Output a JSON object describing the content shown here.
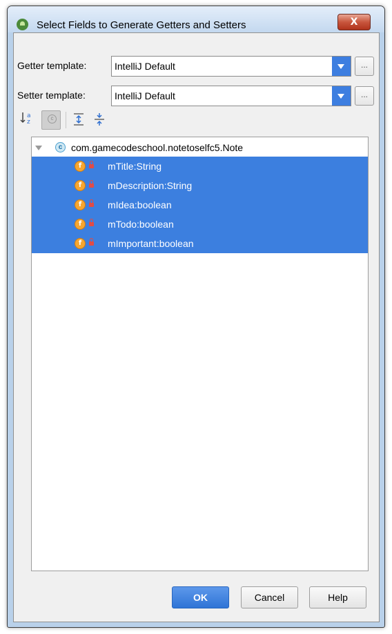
{
  "window": {
    "title": "Select Fields to Generate Getters and Setters",
    "close_glyph": "X"
  },
  "getter": {
    "label": "Getter template:",
    "value": "IntelliJ Default",
    "more": "..."
  },
  "setter": {
    "label": "Setter template:",
    "value": "IntelliJ Default",
    "more": "..."
  },
  "toolbar": {
    "sort_icon": "sort-alphabetically-icon",
    "class_filter_glyph": "c",
    "expand_icon": "expand-all-icon",
    "collapse_icon": "collapse-all-icon"
  },
  "tree": {
    "root": {
      "icon_glyph": "c",
      "label": "com.gamecodeschool.notetoselfc5.Note"
    },
    "field_icon_glyph": "f",
    "fields": [
      {
        "label": "mTitle:String"
      },
      {
        "label": "mDescription:String"
      },
      {
        "label": "mIdea:boolean"
      },
      {
        "label": "mTodo:boolean"
      },
      {
        "label": "mImportant:boolean"
      }
    ]
  },
  "buttons": {
    "ok": "OK",
    "cancel": "Cancel",
    "help": "Help"
  },
  "colors": {
    "selection": "#3c7fdf",
    "accent": "#3d7ee0",
    "field_icon": "#f6a630",
    "lock": "#e14b46"
  }
}
